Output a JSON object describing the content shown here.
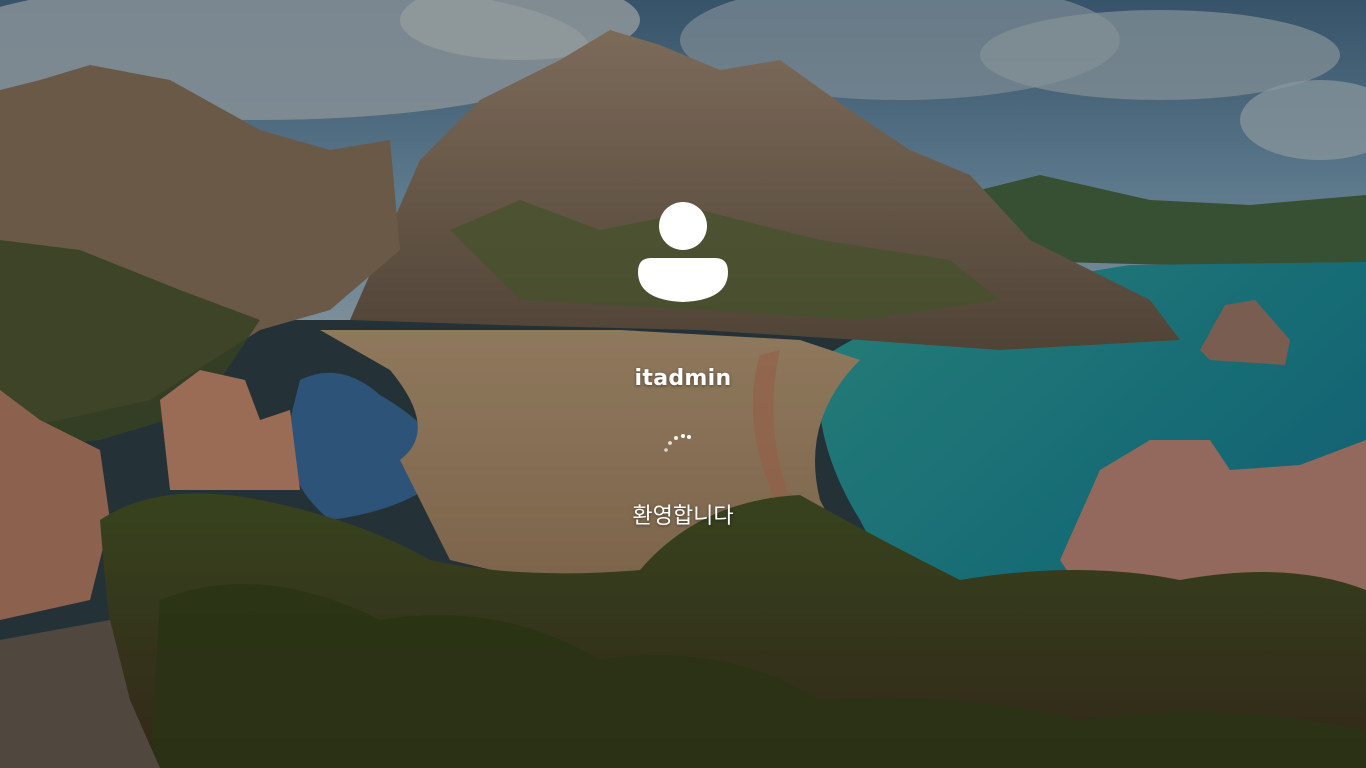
{
  "login": {
    "username": "itadmin",
    "status_text": "환영합니다"
  },
  "icons": {
    "avatar": "user-avatar-icon",
    "spinner": "loading-spinner-icon"
  },
  "colors": {
    "text": "#ffffff",
    "avatar": "#ffffff",
    "sky": "#4d6f8a",
    "water": "#1a8c8a"
  }
}
